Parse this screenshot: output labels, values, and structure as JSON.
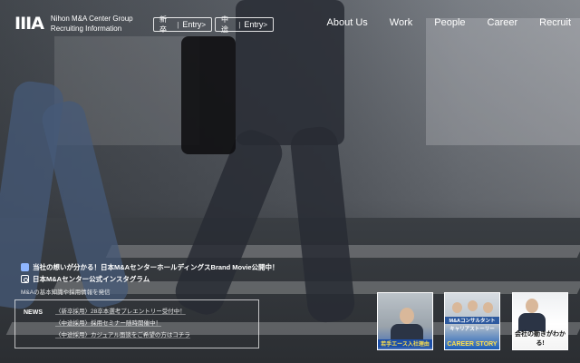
{
  "header": {
    "logo_mark": "IIIA",
    "logo_line1": "Nihon M&A Center Group",
    "logo_line2": "Recruiting Information",
    "entry_new": {
      "kind": "新卒",
      "label": "Entry",
      "arrow": ">"
    },
    "entry_mid": {
      "kind": "中途",
      "label": "Entry",
      "arrow": ">"
    },
    "nav": [
      "About Us",
      "Work",
      "People",
      "Career",
      "Recruit"
    ]
  },
  "notices": {
    "movie": "当社の想いが分かる！日本M&AセンターホールディングスBrand Movie公開中！",
    "instagram": "日本M&Aセンター公式インスタグラム",
    "instagram_sub": "M&Aの基本知識や採用情報を発信"
  },
  "news": {
    "label": "NEWS",
    "items": [
      "〈新卒採用〉28卒本選考プレエントリー受付中！",
      "〈中途採用〉採用セミナー随時開催中！",
      "〈中途採用〉カジュアル面談をご希望の方はコチラ"
    ]
  },
  "banners": [
    {
      "caption": "若手エース入社理由"
    },
    {
      "caption_top": "M&Aコンサルタント",
      "caption_mid": "キャリアストーリー",
      "caption_bottom": "CAREER STORY"
    },
    {
      "caption": "会社の動きがわかる!"
    }
  ]
}
